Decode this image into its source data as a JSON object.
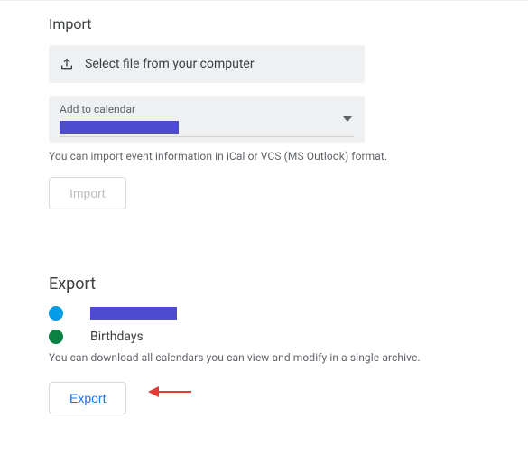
{
  "import": {
    "title": "Import",
    "select_file_label": "Select file from your computer",
    "add_to_calendar_label": "Add to calendar",
    "selected_calendar_color": "#4f4bcf",
    "help_text": "You can import event information in iCal or VCS (MS Outlook) format.",
    "import_button_label": "Import"
  },
  "export": {
    "title": "Export",
    "calendars": [
      {
        "dot_color": "#039be5",
        "label": "",
        "label_redacted": true
      },
      {
        "dot_color": "#0b8043",
        "label": "Birthdays",
        "label_redacted": false
      }
    ],
    "help_text": "You can download all calendars you can view and modify in a single archive.",
    "export_button_label": "Export"
  },
  "annotation": {
    "arrow_color": "#e53935"
  }
}
